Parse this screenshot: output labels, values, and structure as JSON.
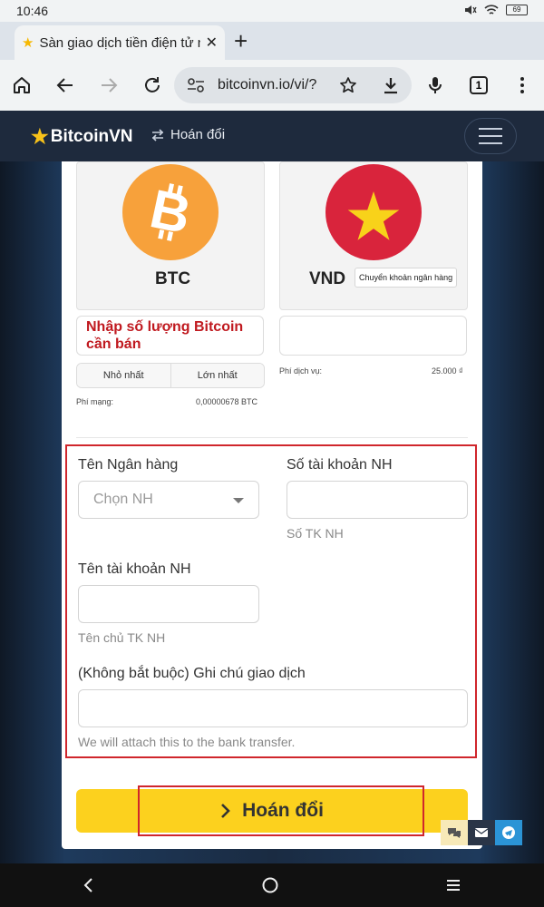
{
  "status": {
    "time": "10:46",
    "battery": "69"
  },
  "browser": {
    "tab_title": "Sàn giao dịch tiền điện tử nh",
    "url": "bitcoinvn.io/vi/?",
    "tab_count": "1"
  },
  "site": {
    "brand": "BitcoinVN",
    "nav_swap": "Hoán đổi"
  },
  "exchange": {
    "from_label": "BTC",
    "to_label": "VND",
    "bank_transfer_chip": "Chuyển khoản ngân hàng",
    "amount_placeholder": "Nhập số lượng Bitcoin cần bán",
    "min_label": "Nhỏ nhất",
    "max_label": "Lớn nhất",
    "network_fee_label": "Phí mạng:",
    "network_fee_value": "0,00000678 BTC",
    "service_fee_label": "Phí dịch vụ:",
    "service_fee_value": "25.000 ₫"
  },
  "bank_form": {
    "bank_name_label": "Tên Ngân hàng",
    "bank_select_value": "Chọn NH",
    "account_number_label": "Số tài khoản NH",
    "account_number_help": "Số TK NH",
    "account_name_label": "Tên tài khoản NH",
    "account_name_help": "Tên chủ TK NH",
    "note_label": "(Không bắt buộc) Ghi chú giao dịch",
    "note_help": "We will attach this to the bank transfer."
  },
  "submit_label": "Hoán đổi",
  "colors": {
    "accent_yellow": "#fcd11e",
    "btc_orange": "#f7a13b",
    "vn_red": "#d9243c",
    "highlight_red": "#d0262c",
    "header_bg": "#1e2a3d"
  }
}
